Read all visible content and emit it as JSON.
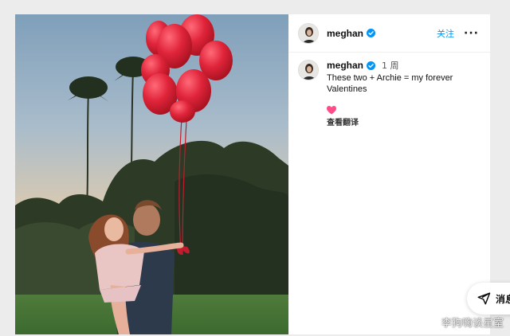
{
  "post": {
    "image_alt": "",
    "author": {
      "username": "meghan",
      "verified": true,
      "avatar_icon": "profile-avatar"
    },
    "header": {
      "follow_label": "关注",
      "more_label": "···"
    },
    "caption": {
      "username": "meghan",
      "time": "1 周",
      "text": "These two + Archie = my forever Valentines",
      "emoji": "pink-heart-icon",
      "translate_label": "查看翻译"
    }
  },
  "messages_button": {
    "icon": "paper-plane-icon",
    "label": "消息"
  },
  "watermark": "李狗嗨谈星室",
  "colors": {
    "accent": "#0095f6",
    "verified": "#0095f6",
    "heart": "#ff4d88",
    "balloon": "#e0243a"
  }
}
